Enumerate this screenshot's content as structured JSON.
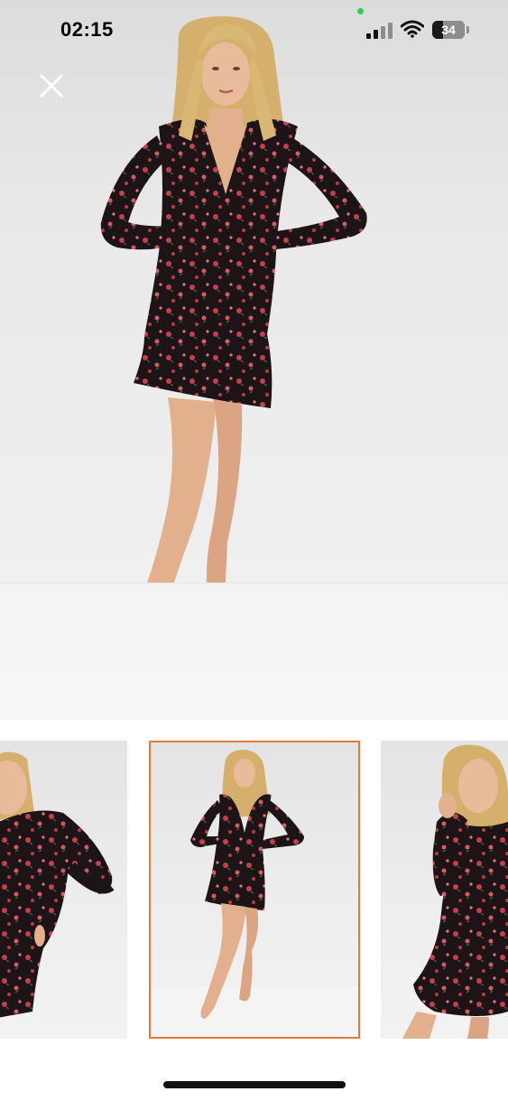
{
  "status_bar": {
    "time": "02:15",
    "battery_level": "34",
    "battery_fraction": 0.34,
    "icons": [
      "signal-icon",
      "wifi-icon",
      "battery-icon"
    ],
    "privacy_dot_color": "#34c759"
  },
  "viewer": {
    "close_icon": "close-icon",
    "main_image": "model-in-floral-mini-dress-front",
    "thumbnails": [
      {
        "name": "model-side-pose",
        "selected": false
      },
      {
        "name": "model-front-full",
        "selected": true
      },
      {
        "name": "model-hand-in-hair",
        "selected": false
      }
    ],
    "selected_border_color": "#e07b39"
  },
  "colors": {
    "dress": "#1c1416",
    "flowers": "#c4404a",
    "skin": "#e3b08e",
    "hair": "#d9b774"
  }
}
